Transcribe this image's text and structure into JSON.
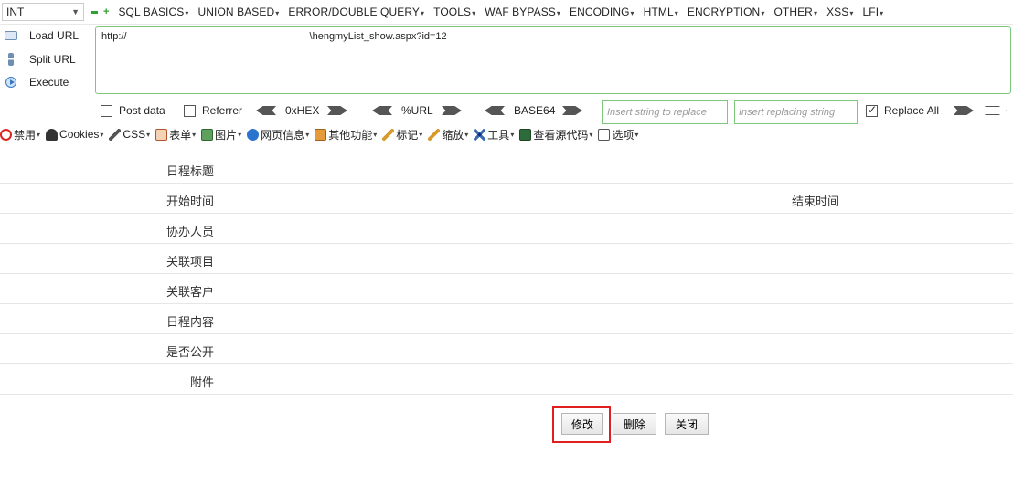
{
  "menubar": {
    "type_select": "INT",
    "items": [
      "SQL BASICS",
      "UNION BASED",
      "ERROR/DOUBLE QUERY",
      "TOOLS",
      "WAF BYPASS",
      "ENCODING",
      "HTML",
      "ENCRYPTION",
      "OTHER",
      "XSS",
      "LFI"
    ]
  },
  "actions": {
    "load_url": "Load URL",
    "split_url": "Split URL",
    "execute": "Execute"
  },
  "url": {
    "prefix": "http://",
    "suffix": "\\hengmyList_show.aspx?id=12"
  },
  "options": {
    "post_data": "Post data",
    "referrer": "Referrer",
    "hex": "0xHEX",
    "url_enc": "%URL",
    "base64": "BASE64",
    "replace_placeholder": "Insert string to replace",
    "replacing_placeholder": "Insert replacing string",
    "replace_all": "Replace All"
  },
  "toolbar2": {
    "items": [
      "禁用",
      "Cookies",
      "CSS",
      "表单",
      "图片",
      "网页信息",
      "其他功能",
      "标记",
      "缩放",
      "工具",
      "查看源代码",
      "选项"
    ]
  },
  "form": {
    "rows": [
      {
        "label": "日程标题"
      },
      {
        "label": "开始时间",
        "label2": "结束时间"
      },
      {
        "label": "协办人员"
      },
      {
        "label": "关联项目"
      },
      {
        "label": "关联客户"
      },
      {
        "label": "日程内容"
      },
      {
        "label": "是否公开"
      },
      {
        "label": "附件"
      }
    ]
  },
  "buttons": {
    "edit": "修改",
    "delete": "删除",
    "close": "关闭"
  },
  "colors": {
    "green_border": "#7bc77b",
    "highlight_red": "#e02020"
  }
}
